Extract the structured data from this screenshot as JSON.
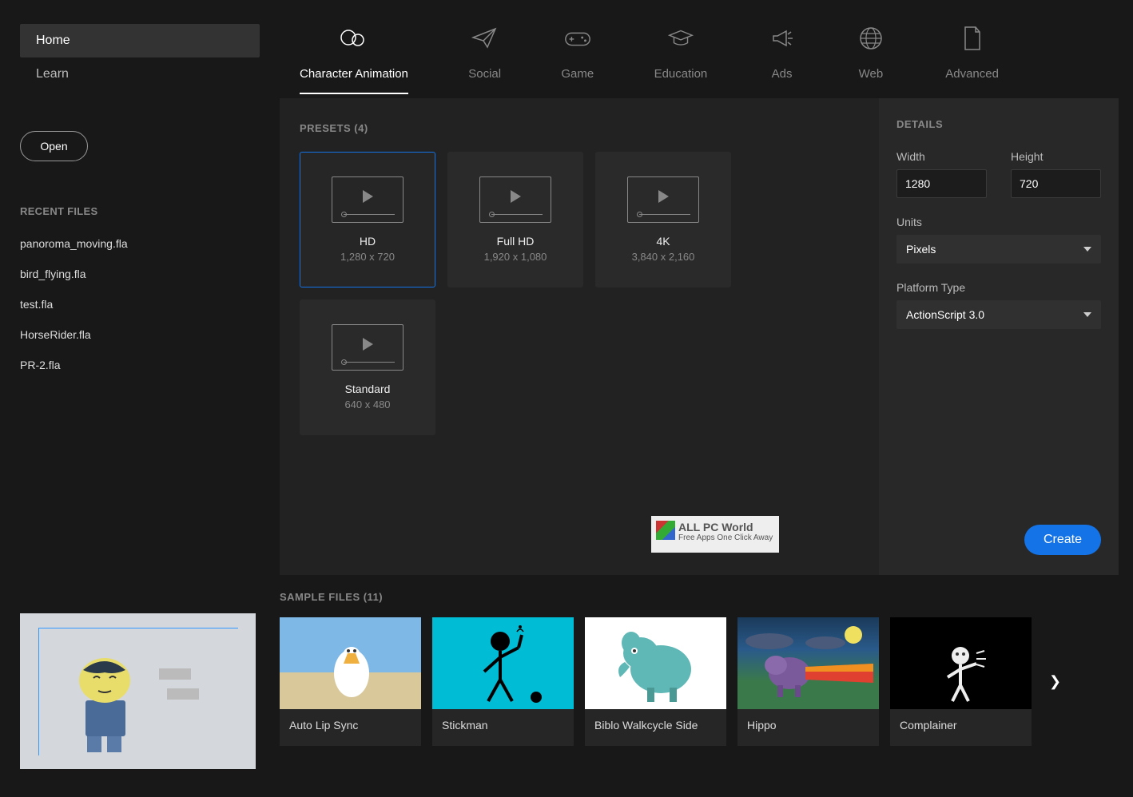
{
  "sidebar": {
    "nav": [
      "Home",
      "Learn"
    ],
    "open_label": "Open",
    "recent_label": "RECENT FILES",
    "recent_files": [
      "panoroma_moving.fla",
      "bird_flying.fla",
      "test.fla",
      "HorseRider.fla",
      "PR-2.fla"
    ]
  },
  "tabs": [
    {
      "label": "Character Animation"
    },
    {
      "label": "Social"
    },
    {
      "label": "Game"
    },
    {
      "label": "Education"
    },
    {
      "label": "Ads"
    },
    {
      "label": "Web"
    },
    {
      "label": "Advanced"
    }
  ],
  "presets": {
    "title": "PRESETS (4)",
    "items": [
      {
        "name": "HD",
        "dim": "1,280 x 720"
      },
      {
        "name": "Full HD",
        "dim": "1,920 x 1,080"
      },
      {
        "name": "4K",
        "dim": "3,840 x 2,160"
      },
      {
        "name": "Standard",
        "dim": "640 x 480"
      }
    ]
  },
  "details": {
    "title": "DETAILS",
    "width_label": "Width",
    "width_value": "1280",
    "height_label": "Height",
    "height_value": "720",
    "units_label": "Units",
    "units_value": "Pixels",
    "platform_label": "Platform Type",
    "platform_value": "ActionScript 3.0",
    "create_label": "Create"
  },
  "samples": {
    "title": "SAMPLE FILES (11)",
    "items": [
      "Auto Lip Sync",
      "Stickman",
      "Biblo Walkcycle Side",
      "Hippo",
      "Complainer"
    ]
  },
  "watermark": {
    "title": "ALL PC World",
    "sub": "Free Apps One Click Away"
  }
}
